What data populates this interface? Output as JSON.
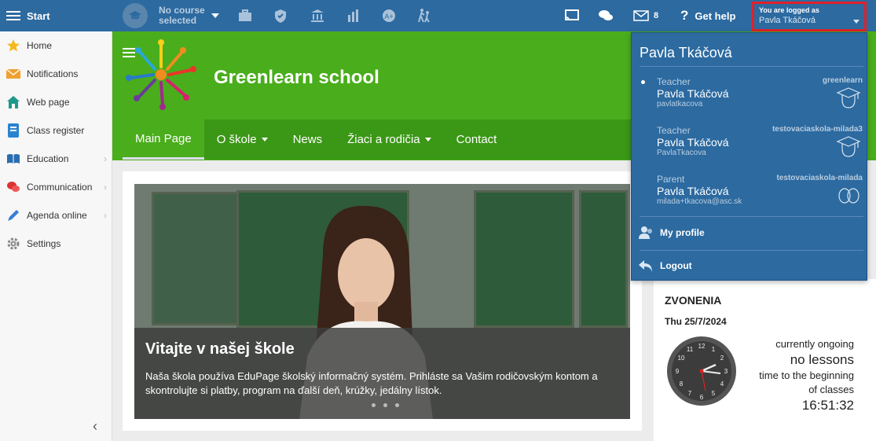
{
  "topbar": {
    "start_label": "Start",
    "course_label": "No course selected",
    "course_line1": "No course",
    "course_line2": "selected",
    "messages_count": "8",
    "help_label": "Get help",
    "logged_as_label": "You are logged as",
    "logged_user": "Pavla Tkáčová"
  },
  "sidebar": {
    "items": [
      {
        "label": "Home",
        "icon": "star-icon"
      },
      {
        "label": "Notifications",
        "icon": "envelope-icon"
      },
      {
        "label": "Web page",
        "icon": "house-icon"
      },
      {
        "label": "Class register",
        "icon": "register-icon"
      },
      {
        "label": "Education",
        "icon": "book-icon"
      },
      {
        "label": "Communication",
        "icon": "chat-icon"
      },
      {
        "label": "Agenda online",
        "icon": "pen-icon"
      },
      {
        "label": "Settings",
        "icon": "gear-icon"
      }
    ]
  },
  "header": {
    "school_name": "Greenlearn school"
  },
  "nav": {
    "items": [
      {
        "label": "Main Page"
      },
      {
        "label": "O škole"
      },
      {
        "label": "News"
      },
      {
        "label": "Žiaci a rodičia"
      },
      {
        "label": "Contact"
      }
    ]
  },
  "hero": {
    "title": "Vitajte v našej škole",
    "text": "Naša škola používa EduPage školský informačný systém. Prihláste sa Vašim rodičovským kontom a skontrolujte si platby, program na ďalší deň, krúžky, jedálny lístok."
  },
  "bells": {
    "title": "ZVONENIA",
    "date": "Thu 25/7/2024",
    "status1": "currently ongoing",
    "status2": "no lessons",
    "status3": "time to the beginning of classes",
    "time": "16:51:32"
  },
  "dropdown": {
    "user_name": "Pavla Tkáčová",
    "accounts": [
      {
        "role": "Teacher",
        "school": "greenlearn",
        "name": "Pavla Tkáčová",
        "username": "pavlatkacova",
        "icon": "graduate-icon"
      },
      {
        "role": "Teacher",
        "school": "testovaciaskola-milada3",
        "name": "Pavla Tkáčová",
        "username": "PavlaTkacova",
        "icon": "graduate-icon"
      },
      {
        "role": "Parent",
        "school": "testovaciaskola-milada",
        "name": "Pavla Tkáčová",
        "username": "milada+tkacova@asc.sk",
        "icon": "parent-icon"
      }
    ],
    "my_profile": "My profile",
    "logout": "Logout"
  },
  "colors": {
    "topbar": "#2c6aa0",
    "header_green": "#4aad1c",
    "nav_green": "#3b9716",
    "highlight": "#e0212a"
  }
}
